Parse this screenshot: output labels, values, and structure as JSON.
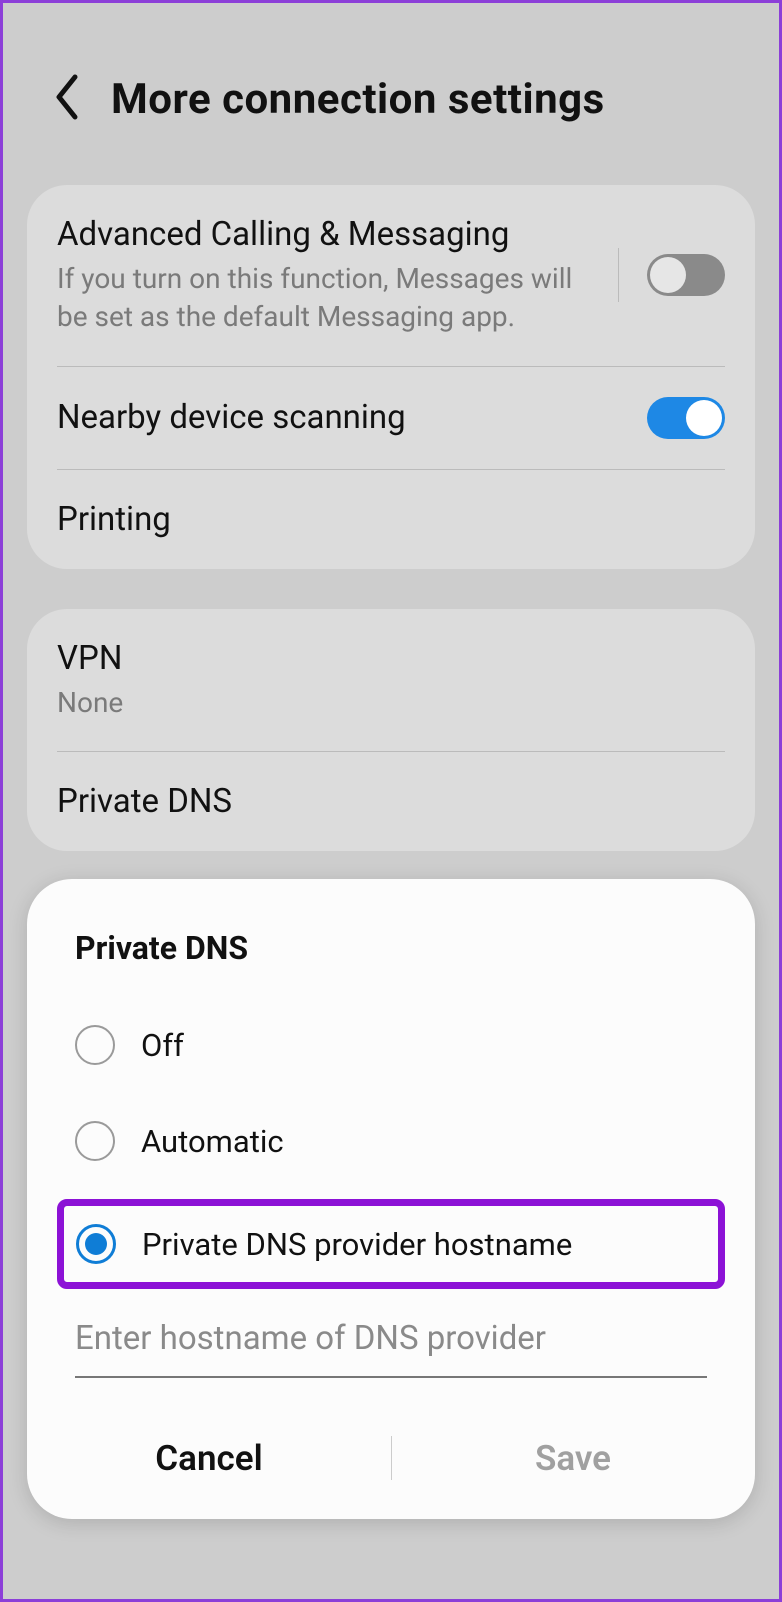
{
  "header": {
    "title": "More connection settings"
  },
  "settings": {
    "advanced_calling": {
      "title": "Advanced Calling & Messaging",
      "subtitle": "If you turn on this function, Messages will be set as the default Messaging app.",
      "enabled": false
    },
    "nearby_scanning": {
      "title": "Nearby device scanning",
      "enabled": true
    },
    "printing": {
      "title": "Printing"
    },
    "vpn": {
      "title": "VPN",
      "value": "None"
    },
    "private_dns": {
      "title": "Private DNS"
    }
  },
  "dialog": {
    "title": "Private DNS",
    "options": {
      "off": "Off",
      "automatic": "Automatic",
      "hostname": "Private DNS provider hostname"
    },
    "selected": "hostname",
    "input_placeholder": "Enter hostname of DNS provider",
    "cancel": "Cancel",
    "save": "Save"
  }
}
